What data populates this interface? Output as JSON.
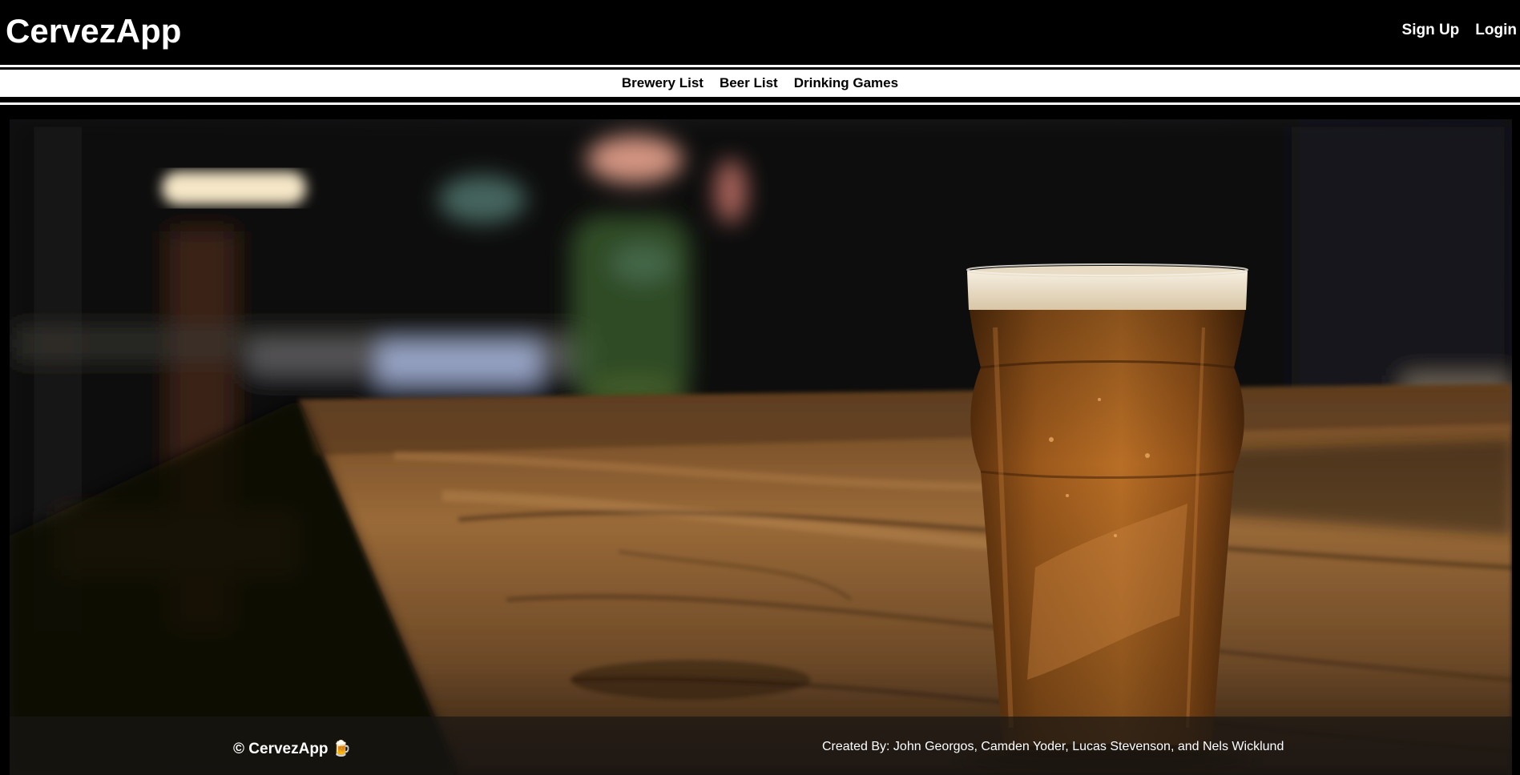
{
  "header": {
    "brand": "CervezApp",
    "auth": {
      "signup": "Sign Up",
      "login": "Login"
    }
  },
  "nav": {
    "items": [
      {
        "label": "Brewery List"
      },
      {
        "label": "Beer List"
      },
      {
        "label": "Drinking Games"
      }
    ]
  },
  "hero": {
    "description": "blurred bar scene with a pint of beer on a wooden table"
  },
  "footer": {
    "copyright": "© CervezApp 🍺",
    "credits": "Created By: John Georgos, Camden Yoder, Lucas Stevenson, and Nels Wicklund"
  },
  "colors": {
    "background": "#000000",
    "nav_bg": "#ffffff",
    "beer": "#b86a1f",
    "foam": "#f0e6d2",
    "wood": "#8a5a2c"
  }
}
